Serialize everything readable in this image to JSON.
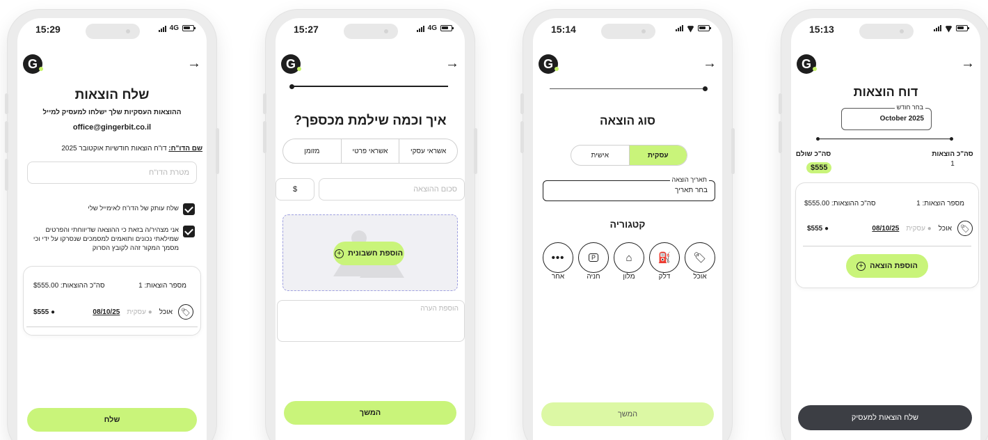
{
  "colors": {
    "accent": "#c9f47a",
    "dark_button": "#3c3e44",
    "dashed_border": "#9e9fe0"
  },
  "logo_letter": "G",
  "status_icons": [
    "cellular-bars-icon",
    "wifi-icon",
    "battery-icon"
  ],
  "screen1": {
    "time": "15:29",
    "network": "4G",
    "title": "שלח הוצאות",
    "subtitle": "ההוצאות העסקיות שלך ישלחו למעסיק למייל",
    "email": "office@gingerbit.co.il",
    "report_name_label": "שם הדו\"ח:",
    "report_name_value": "דו\"ח הוצאות חודשיות אוקטובר 2025",
    "report_purpose_placeholder": "מטרת הדו\"ח",
    "checkbox_copy_label": "שלח עותק של הדו\"ח לאימייל שלי",
    "checkbox_declare_label": "אני מצהיר/ה בזאת כי ההוצאה שדיווחתי והפרטים שמילאתי נכונים ותואמים למסמכים שנסרקו על ידי וכי מסמך המקור זהה לקובץ הסרוק",
    "card": {
      "count_label": "מספר הוצאות: 1",
      "total_label": "סה\"כ ההוצאות: $555.00",
      "item": {
        "category": "אוכל",
        "type": "עסקית",
        "date": "08/10/25",
        "amount": "$555"
      }
    },
    "send_button": "שלח"
  },
  "screen2": {
    "time": "15:27",
    "network": "4G",
    "title": "איך וכמה שילמת מכספך?",
    "payment_methods": [
      "אשראי עסקי",
      "אשראי פרטי",
      "מזומן"
    ],
    "currency": "$",
    "amount_placeholder": "סכום ההוצאה",
    "add_invoice_button": "הוספת חשבונית",
    "note_placeholder": "הוספת הערה",
    "continue_button": "המשך"
  },
  "screen3": {
    "time": "15:14",
    "title": "סוג הוצאה",
    "expense_types": [
      "עסקית",
      "אישית"
    ],
    "selected_type": "עסקית",
    "date_field_label": "תאריך הוצאה",
    "date_field_value": "בחר תאריך",
    "category_title": "קטגוריה",
    "categories": [
      {
        "label": "אוכל",
        "icon": "food-icon"
      },
      {
        "label": "דלק",
        "icon": "fuel-icon"
      },
      {
        "label": "מלון",
        "icon": "hotel-icon"
      },
      {
        "label": "חניה",
        "icon": "parking-icon"
      },
      {
        "label": "אחר",
        "icon": "more-icon"
      }
    ],
    "continue_button": "המשך"
  },
  "screen4": {
    "time": "15:13",
    "title": "דוח הוצאות",
    "month_label": "בחר חודש",
    "month_value": "October 2025",
    "total_expenses_label": "סה\"כ הוצאות",
    "total_expenses_value": "1",
    "total_paid_label": "סה\"כ שולם",
    "total_paid_value": "$555",
    "card": {
      "count_label": "מספר הוצאות: 1",
      "total_label": "סה\"כ ההוצאות: $555.00",
      "item": {
        "category": "אוכל",
        "type": "עסקית",
        "date": "08/10/25",
        "amount": "$555"
      }
    },
    "add_expense_button": "הוספת הוצאה",
    "send_to_employer_button": "שלח הוצאות למעסיק"
  }
}
